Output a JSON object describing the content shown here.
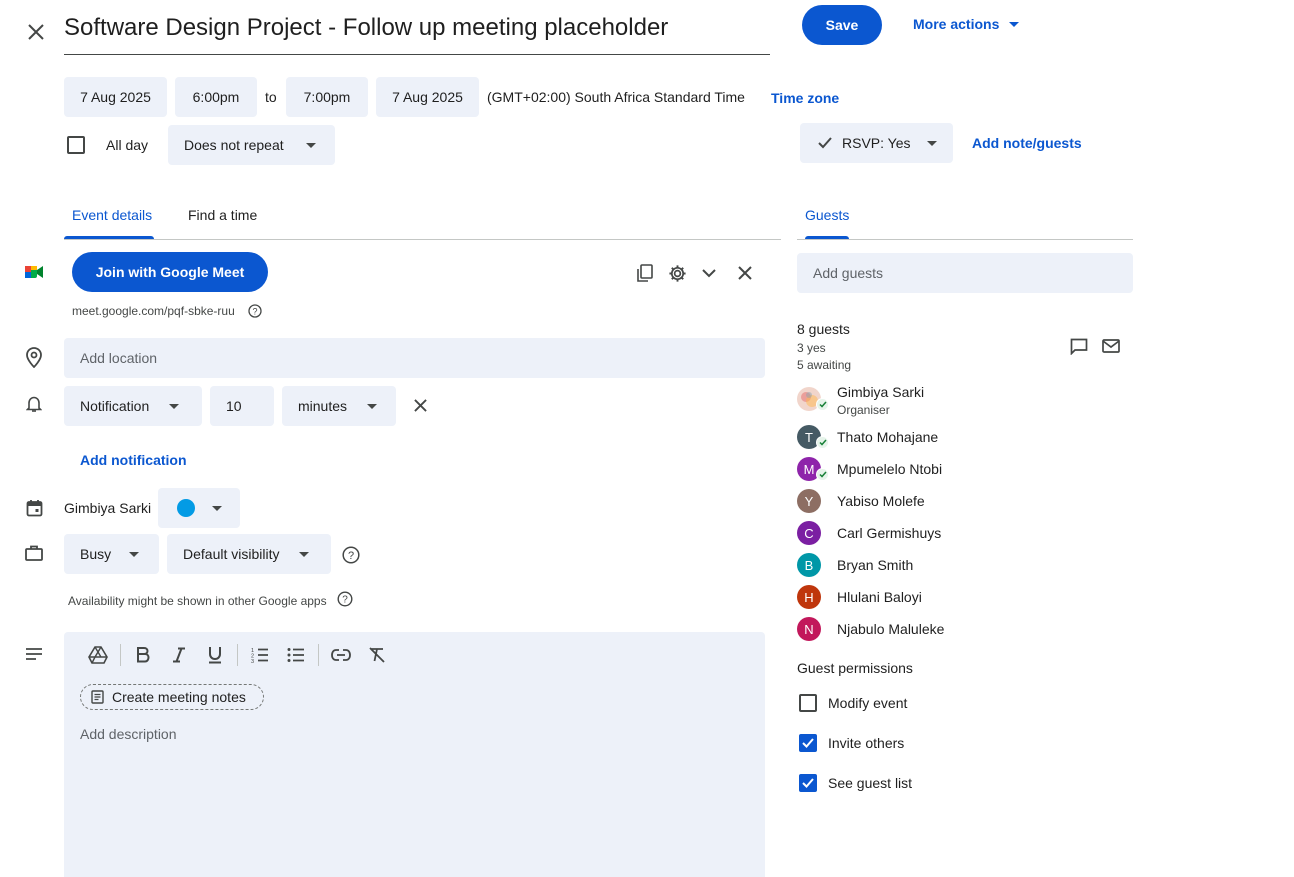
{
  "header": {
    "title": "Software Design Project - Follow up meeting placeholder",
    "save_label": "Save",
    "more_actions_label": "More actions"
  },
  "datetime": {
    "start_date": "7 Aug 2025",
    "start_time": "6:00pm",
    "to_label": "to",
    "end_time": "7:00pm",
    "end_date": "7 Aug 2025",
    "timezone_text": "(GMT+02:00) South Africa Standard Time",
    "timezone_link": "Time zone",
    "all_day_label": "All day",
    "all_day_checked": false,
    "repeat_value": "Does not repeat"
  },
  "rsvp": {
    "label": "RSVP: Yes",
    "add_note_label": "Add note/guests"
  },
  "tabs": {
    "event_details": "Event details",
    "find_time": "Find a time",
    "guests": "Guests"
  },
  "meet": {
    "join_label": "Join with Google Meet",
    "link": "meet.google.com/pqf-sbke-ruu"
  },
  "location": {
    "placeholder": "Add location"
  },
  "notification": {
    "type": "Notification",
    "value": "10",
    "unit": "minutes",
    "add_label": "Add notification"
  },
  "calendar": {
    "owner": "Gimbiya Sarki",
    "color": "#039be5"
  },
  "availability": {
    "status": "Busy",
    "visibility": "Default visibility",
    "note": "Availability might be shown in other Google apps"
  },
  "description": {
    "notes_button": "Create meeting notes",
    "placeholder": "Add description"
  },
  "guests": {
    "input_placeholder": "Add guests",
    "count": "8 guests",
    "yes_count": "3 yes",
    "awaiting_count": "5 awaiting",
    "list": [
      {
        "initial": "",
        "name": "Gimbiya Sarki",
        "role": "Organiser",
        "color": "#e8c4b8",
        "accepted": true
      },
      {
        "initial": "T",
        "name": "Thato Mohajane",
        "role": "",
        "color": "#455a64",
        "accepted": true
      },
      {
        "initial": "M",
        "name": "Mpumelelo Ntobi",
        "role": "",
        "color": "#8e24aa",
        "accepted": true
      },
      {
        "initial": "Y",
        "name": "Yabiso Molefe",
        "role": "",
        "color": "#8d6e63",
        "accepted": false
      },
      {
        "initial": "C",
        "name": "Carl Germishuys",
        "role": "",
        "color": "#7b1fa2",
        "accepted": false
      },
      {
        "initial": "B",
        "name": "Bryan Smith",
        "role": "",
        "color": "#0097a7",
        "accepted": false
      },
      {
        "initial": "H",
        "name": "Hlulani Baloyi",
        "role": "",
        "color": "#bf360c",
        "accepted": false
      },
      {
        "initial": "N",
        "name": "Njabulo Maluleke",
        "role": "",
        "color": "#c2185b",
        "accepted": false
      }
    ]
  },
  "permissions": {
    "title": "Guest permissions",
    "modify_label": "Modify event",
    "modify_checked": false,
    "invite_label": "Invite others",
    "invite_checked": true,
    "see_list_label": "See guest list",
    "see_list_checked": true
  },
  "colors": {
    "accent": "#0b57d0",
    "field_bg": "#edf1f9"
  }
}
